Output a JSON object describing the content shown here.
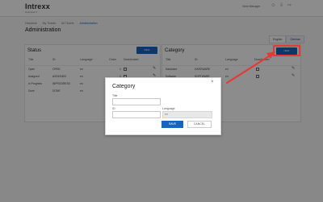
{
  "app": {
    "logo": "Intrexx",
    "logo_sub": "Helpdesk 3",
    "view_manager": "View Manager"
  },
  "breadcrumb": [
    "Helpdesk",
    "My Tickets",
    "All Tickets",
    "Administration"
  ],
  "page_title": "Administration",
  "language_tabs": [
    "English",
    "German"
  ],
  "status_panel": {
    "title": "Status",
    "new_label": "NEW",
    "columns": [
      "Title",
      "ID",
      "Language",
      "Order",
      "Deactivated"
    ],
    "rows": [
      {
        "title": "Open",
        "id": "OPEN",
        "language": "en",
        "order": "1"
      },
      {
        "title": "Assigned",
        "id": "ASSIGNED",
        "language": "en",
        "order": "2"
      },
      {
        "title": "In Progress",
        "id": "INPROGRESS",
        "language": "en",
        "order": "3"
      },
      {
        "title": "Done",
        "id": "DONE",
        "language": "en",
        "order": "4"
      }
    ]
  },
  "category_panel": {
    "title": "Category",
    "new_label": "NEW",
    "columns": [
      "Title",
      "ID",
      "Language",
      "Deactivated"
    ],
    "rows": [
      {
        "title": "Hardware",
        "id": "HARDWARE",
        "language": "en"
      },
      {
        "title": "Software",
        "id": "SOFTWARE",
        "language": "en"
      }
    ]
  },
  "dialog": {
    "title": "Category",
    "close": "×",
    "fields": {
      "title_label": "Title",
      "id_label": "ID",
      "language_label": "Language",
      "language_value": "en"
    },
    "save_label": "SAVE",
    "cancel_label": "CANCEL"
  },
  "colors": {
    "accent": "#1565c0",
    "highlight": "#e53935"
  }
}
